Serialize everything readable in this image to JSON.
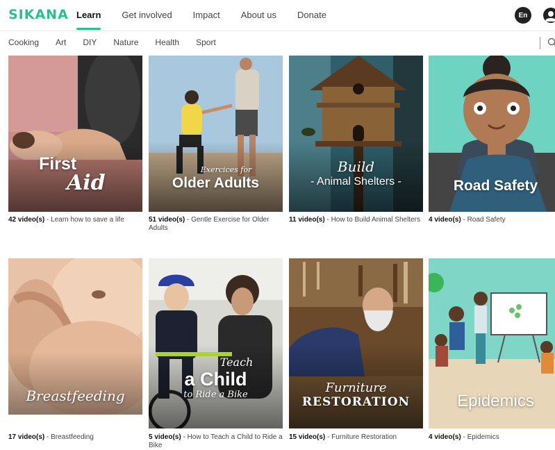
{
  "brand": {
    "logo": "SIKANA",
    "accent": "#2bbf8e"
  },
  "nav": {
    "items": [
      "Learn",
      "Get involved",
      "Impact",
      "About us",
      "Donate"
    ],
    "active": "Learn",
    "lang": "En"
  },
  "categories": [
    "Cooking",
    "Art",
    "DIY",
    "Nature",
    "Health",
    "Sport"
  ],
  "icons": {
    "user": "user-icon",
    "search": "search-icon"
  },
  "cards": [
    {
      "title_line1": "First",
      "title_line2": "Aid",
      "count": "42 video(s)",
      "desc": " - Learn how to save a life"
    },
    {
      "title_script": "Exercices for",
      "title_main": "Older Adults",
      "count": "51 video(s)",
      "desc": " - Gentle Exercise for Older Adults"
    },
    {
      "title_script": "Build",
      "title_main": "- Animal Shelters -",
      "count": "11 video(s)",
      "desc": " - How to Build Animal Shelters"
    },
    {
      "title_main": "Road Safety",
      "count": "4 video(s)",
      "desc": " - Road Safety"
    },
    {
      "title_script": "Breastfeeding",
      "count": "17 video(s)",
      "desc": " - Breastfeeding"
    },
    {
      "title_script": "Teach",
      "title_main": "a Child",
      "title_sub": "to Ride a Bike",
      "count": "5 video(s)",
      "desc": " - How to Teach a Child to Ride a Bike"
    },
    {
      "title_script": "Furniture",
      "title_main": "RESTORATION",
      "count": "15 video(s)",
      "desc": " - Furniture Restoration"
    },
    {
      "title_main": "Epidemics",
      "count": "4 video(s)",
      "desc": " - Epidemics"
    }
  ]
}
